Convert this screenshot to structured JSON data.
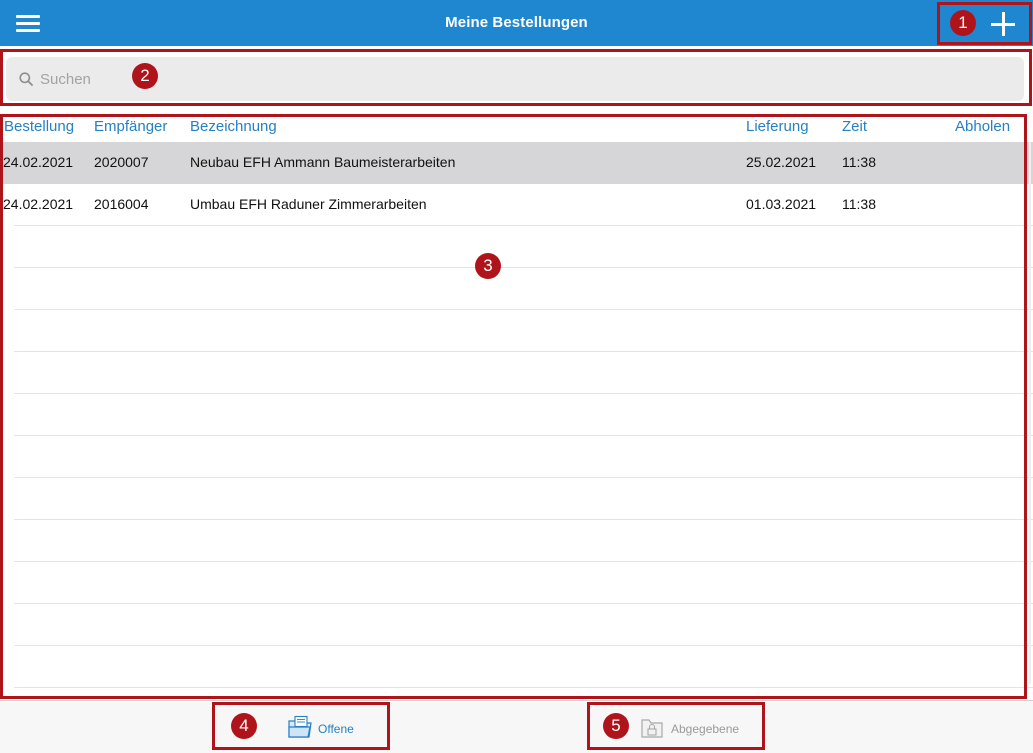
{
  "header": {
    "title": "Meine Bestellungen",
    "menu_icon": "hamburger-menu-icon",
    "add_icon": "plus-icon"
  },
  "search": {
    "placeholder": "Suchen",
    "value": "",
    "icon": "magnifier-icon"
  },
  "table": {
    "columns": [
      "Bestellung",
      "Empfänger",
      "Bezeichnung",
      "Lieferung",
      "Zeit",
      "Abholen"
    ],
    "rows": [
      {
        "bestellung": "24.02.2021",
        "empfaenger": "2020007",
        "bezeichnung": "Neubau EFH Ammann Baumeisterarbeiten",
        "lieferung": "25.02.2021",
        "zeit": "11:38",
        "abholen": "",
        "selected": true
      },
      {
        "bestellung": "24.02.2021",
        "empfaenger": "2016004",
        "bezeichnung": "Umbau EFH Raduner Zimmerarbeiten",
        "lieferung": "01.03.2021",
        "zeit": "11:38",
        "abholen": "",
        "selected": false
      }
    ]
  },
  "tabs": [
    {
      "label": "Offene",
      "icon": "folder-document-icon",
      "active": true
    },
    {
      "label": "Abgegebene",
      "icon": "locked-folder-icon",
      "active": false
    }
  ],
  "annotations": [
    "1",
    "2",
    "3",
    "4",
    "5"
  ],
  "colors": {
    "header": "#1f87d0",
    "accent": "#2581c4",
    "annotation": "#b0141b",
    "selected_row": "#d6d6d8"
  }
}
